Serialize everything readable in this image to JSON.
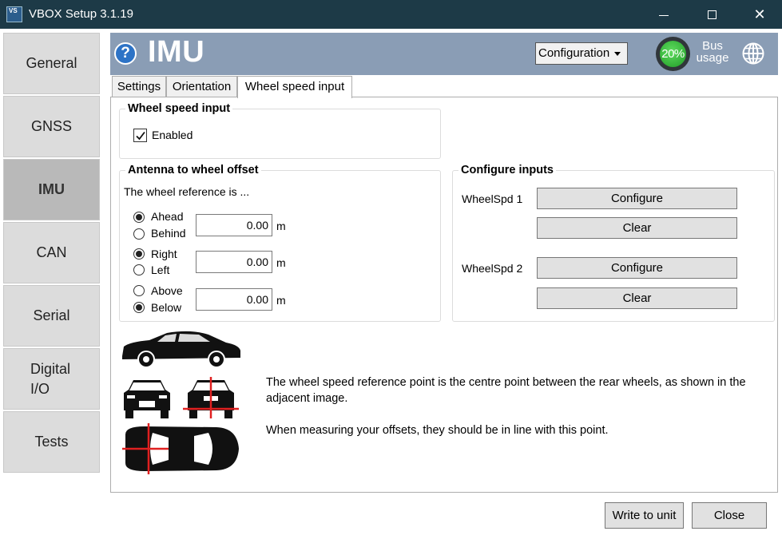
{
  "window": {
    "app_icon": "VS",
    "title": "VBOX Setup 3.1.19",
    "close_glyph": "✕"
  },
  "sidebar": {
    "items": [
      {
        "label": "General"
      },
      {
        "label": "GNSS"
      },
      {
        "label": "IMU",
        "active": true
      },
      {
        "label": "CAN"
      },
      {
        "label": "Serial"
      },
      {
        "label": "Digital I/O",
        "lines": [
          "Digital",
          "I/O"
        ]
      },
      {
        "label": "Tests"
      }
    ]
  },
  "header": {
    "help_glyph": "?",
    "title": "IMU",
    "config_select": "Configuration",
    "bus_usage_value": "20%",
    "bus_label_1": "Bus",
    "bus_label_2": "usage",
    "icons": [
      "help-icon",
      "globe-icon"
    ]
  },
  "tabs": [
    {
      "label": "Settings"
    },
    {
      "label": "Orientation"
    },
    {
      "label": "Wheel speed input",
      "active": true
    }
  ],
  "wheel_speed_input": {
    "title": "Wheel speed input",
    "enabled_label": "Enabled",
    "enabled": true
  },
  "antenna_offset": {
    "title": "Antenna to wheel offset",
    "intro": "The wheel reference is ...",
    "unit": "m",
    "rows": [
      {
        "option_a": "Ahead",
        "option_b": "Behind",
        "selected": "Ahead",
        "value": "0.00"
      },
      {
        "option_a": "Right",
        "option_b": "Left",
        "selected": "Right",
        "value": "0.00"
      },
      {
        "option_a": "Above",
        "option_b": "Below",
        "selected": "Below",
        "value": "0.00"
      }
    ]
  },
  "configure_inputs": {
    "title": "Configure inputs",
    "inputs": [
      {
        "label": "WheelSpd 1",
        "configure": "Configure",
        "clear": "Clear"
      },
      {
        "label": "WheelSpd 2",
        "configure": "Configure",
        "clear": "Clear"
      }
    ]
  },
  "info": {
    "paragraph_1": "The wheel speed reference point is the centre point between the rear wheels, as shown in the adjacent image.",
    "paragraph_2": "When measuring your offsets, they should be in line with this point."
  },
  "footer": {
    "write_label": "Write to unit",
    "close_label": "Close"
  },
  "colors": {
    "titlebar": "#1d3a47",
    "header": "#8a9db5",
    "bus_gauge": "#2bb32f",
    "reference_marker": "#e02020"
  }
}
